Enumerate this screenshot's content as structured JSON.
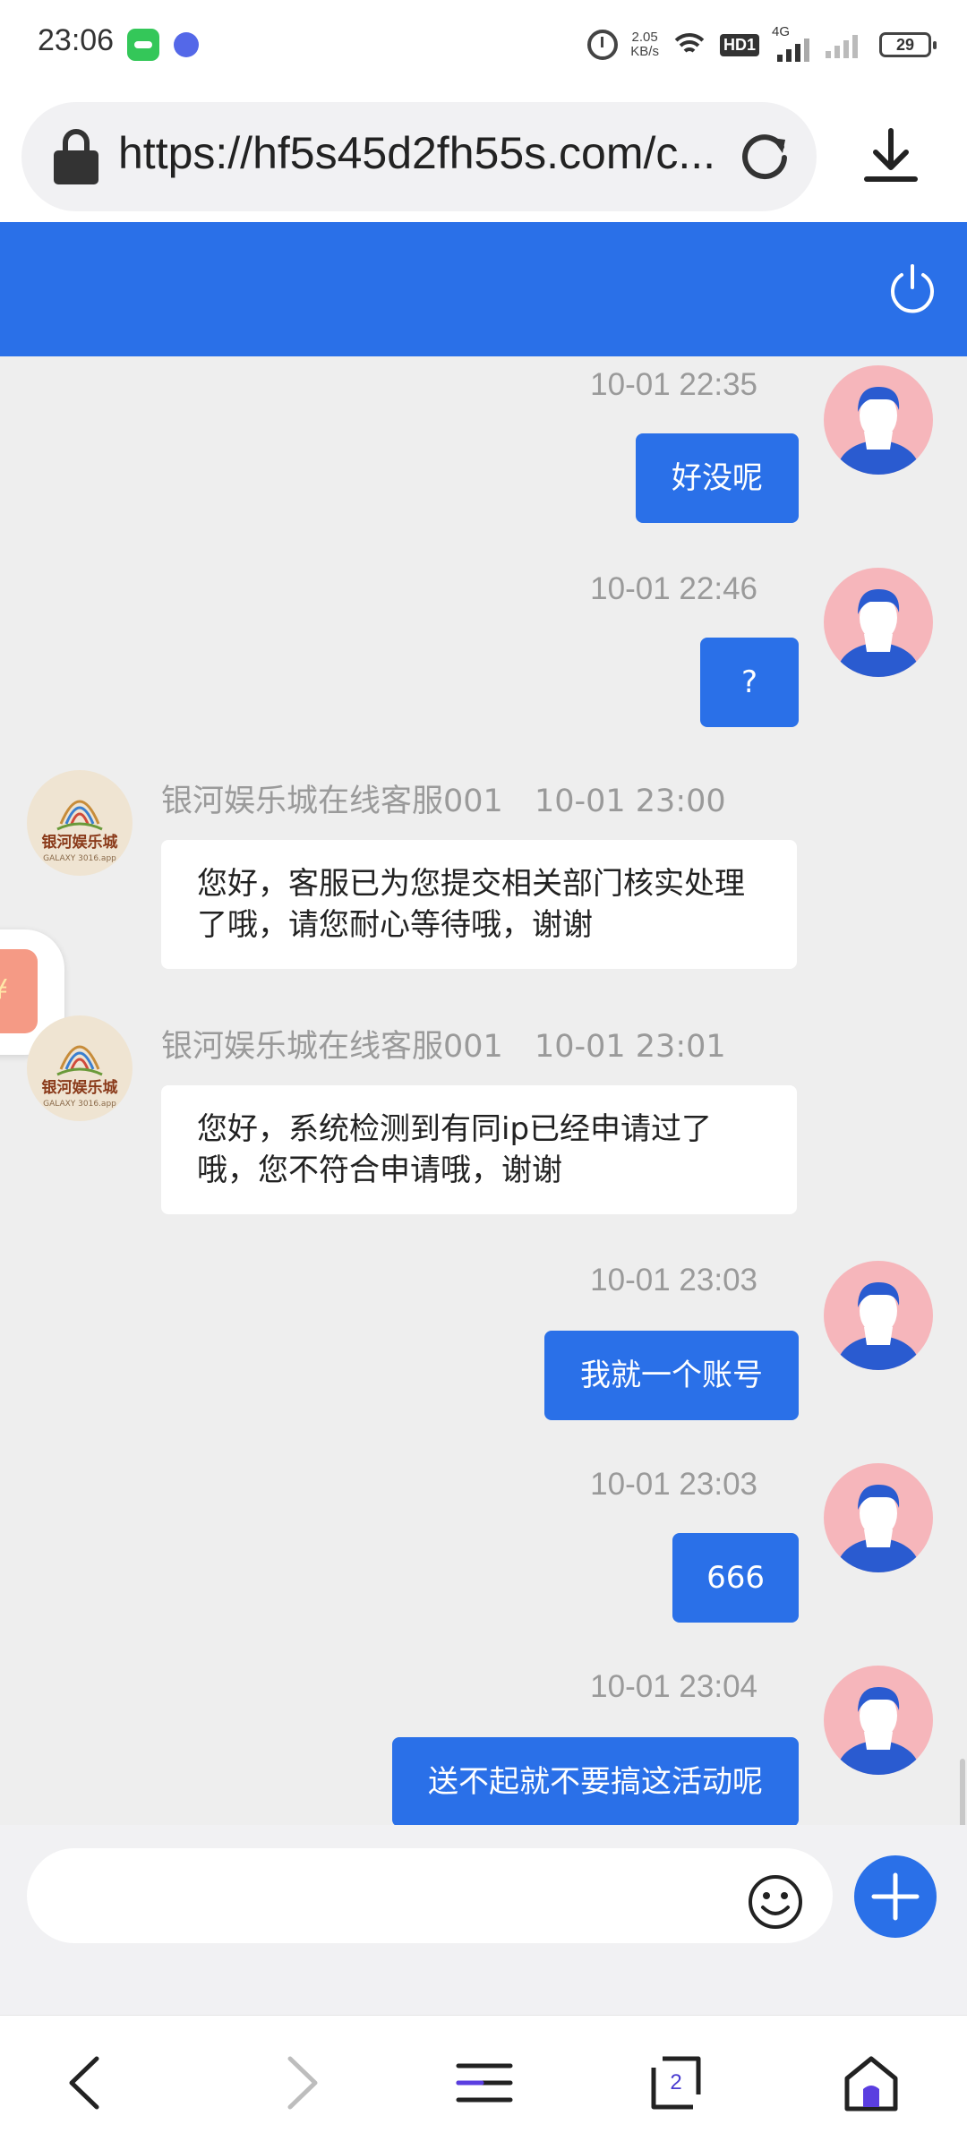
{
  "status_bar": {
    "time": "23:06",
    "net_speed_value": "2.05",
    "net_speed_unit": "KB/s",
    "hd_label": "HD1",
    "network_type": "4G",
    "battery": "29"
  },
  "browser": {
    "url": "https://hf5s45d2fh55s.com/c...",
    "tab_count": "2"
  },
  "chat": {
    "agent_name": "银河娱乐城在线客服001",
    "agent_logo_text": "银河娱乐城",
    "agent_logo_subtext": "GALAXY 3016.app",
    "messages": [
      {
        "side": "out",
        "time": "10-01 22:35",
        "text": "好没呢"
      },
      {
        "side": "out",
        "time": "10-01 22:46",
        "text": "?"
      },
      {
        "side": "in",
        "time": "10-01 23:00",
        "text": "您好，客服已为您提交相关部门核实处理了哦，请您耐心等待哦，谢谢"
      },
      {
        "side": "in",
        "time": "10-01 23:01",
        "text": "您好，系统检测到有同ip已经申请过了哦，您不符合申请哦，谢谢"
      },
      {
        "side": "out",
        "time": "10-01 23:03",
        "text": "我就一个账号"
      },
      {
        "side": "out",
        "time": "10-01 23:03",
        "text": "666"
      },
      {
        "side": "out",
        "time": "10-01 23:04",
        "text": "送不起就不要搞这活动呢"
      }
    ]
  },
  "input": {
    "placeholder": ""
  },
  "colors": {
    "brand_blue": "#2a70e8",
    "avatar_pink": "#f6b6bb",
    "chat_bg": "#eeeeee"
  },
  "icons": [
    "lock-icon",
    "reload-icon",
    "download-icon",
    "power-icon",
    "emoji-icon",
    "plus-icon",
    "back-icon",
    "forward-icon",
    "menu-icon",
    "tabs-icon",
    "home-icon"
  ]
}
